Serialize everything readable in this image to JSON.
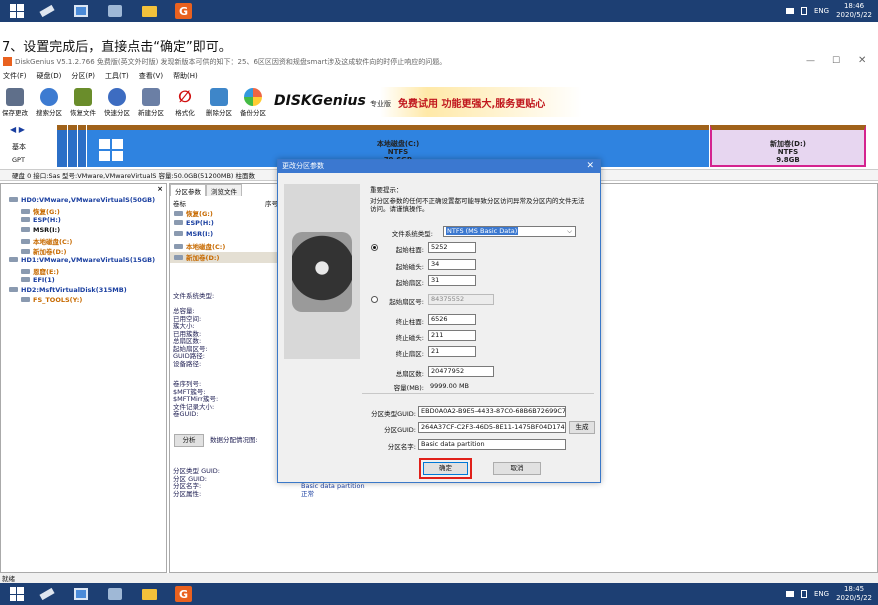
{
  "taskbar": {
    "lang": "ENG",
    "top_time": "18:46",
    "top_date": "2020/5/22",
    "bottom_time": "18:45",
    "bottom_date": "2020/5/22"
  },
  "caption": "7、设置完成后，直接点击“确定”即可。",
  "app": {
    "title": "DiskGenius V5.1.2.766 免费版(英文外时版)   发现新版本可供的知下：25、6区区因资和规盘smart涉及这成软件向的时停止响应的问题。",
    "menu": [
      "文件(F)",
      "硬盘(D)",
      "分区(P)",
      "工具(T)",
      "查看(V)",
      "帮助(H)"
    ],
    "toolbar": [
      "保存更改",
      "搜索分区",
      "恢复文件",
      "快速分区",
      "新建分区",
      "格式化",
      "删除分区",
      "备份分区"
    ],
    "banner_brand": "DISKGenius",
    "banner_tag": "专业版",
    "banner_text": "免费试用 功能更强大,服务更贴心"
  },
  "disk": {
    "basic": "基本",
    "gpt": "GPT",
    "main_name": "本地磁盘(C:)",
    "main_fs": "NTFS",
    "main_size": "79.6GB",
    "right_name": "新加卷(D:)",
    "right_fs": "NTFS",
    "right_size": "9.8GB",
    "info": "硬盘 0 接口:Sas  型号:VMware,VMwareVirtualS  容量:50.0GB(51200MB)  柱面数"
  },
  "tree": [
    {
      "text": "HD0:VMware,VMwareVirtualS(50GB)",
      "cls": "blue"
    },
    {
      "text": "恢复(G:)",
      "cls": "orange"
    },
    {
      "text": "ESP(H:)",
      "cls": "blue"
    },
    {
      "text": "MSR(I:)",
      "cls": ""
    },
    {
      "text": "本地磁盘(C:)",
      "cls": "orange"
    },
    {
      "text": "新加卷(D:)",
      "cls": "orange"
    },
    {
      "text": "HD1:VMware,VMwareVirtualS(15GB)",
      "cls": "blue"
    },
    {
      "text": "恩窟(E:)",
      "cls": "orange"
    },
    {
      "text": "EFI(1)",
      "cls": "blue"
    },
    {
      "text": "HD2:MsftVirtualDisk(315MB)",
      "cls": "blue"
    },
    {
      "text": "FS_TOOLS(Y:)",
      "cls": "orange"
    }
  ],
  "panel": {
    "tab1": "分区参数",
    "tab2": "浏览文件",
    "col_label": "卷标",
    "col_seq": "序号",
    "partitions": [
      "恢复(G:)",
      "ESP(H:)",
      "MSR(I:)",
      "本地磁盘(C:)",
      "新加卷(D:)"
    ],
    "fs_type_label": "文件系统类型:",
    "info_labels": [
      "总容量:",
      "已用空间:",
      "簇大小:",
      "已用簇数:",
      "总扇区数:",
      "起始扇区号:",
      "GUID路径:",
      "设备路径:"
    ],
    "info_labels2": [
      "卷序列号:",
      "$MFT簇号:",
      "$MFTMirr簇号:",
      "文件记录大小:",
      "卷GUID:"
    ],
    "analyze_button": "分析",
    "analyze_label": "数据分配情况图:",
    "bottom_labels": [
      "分区类型 GUID:",
      "分区 GUID:",
      "分区名字:",
      "分区属性:"
    ],
    "bottom_values": [
      "",
      "",
      "Basic data partition",
      "正常"
    ]
  },
  "dialog": {
    "title": "更改分区参数",
    "notice_title": "重要提示：",
    "notice_text": "对分区参数的任何不正确设置都可能导致分区访问异常及分区内的文件无法访问。请谨慎操作。",
    "fs_label": "文件系统类型:",
    "fs_value": "NTFS (MS Basic Data)",
    "start_cyl_label": "起始柱面:",
    "start_cyl": "5252",
    "start_head_label": "起始磁头:",
    "start_head": "34",
    "start_sector_label": "起始扇区:",
    "start_sector": "31",
    "lba_label": "起始扇区号:",
    "lba_value": "84375552",
    "end_cyl_label": "终止柱面:",
    "end_cyl": "6526",
    "end_head_label": "终止磁头:",
    "end_head": "211",
    "end_sector_label": "终止扇区:",
    "end_sector": "21",
    "total_label": "总扇区数:",
    "total_value": "20477952",
    "capacity_label": "容量(MB):",
    "capacity_value": "9999.00 MB",
    "type_guid_label": "分区类型GUID:",
    "type_guid": "EBD0A0A2-B9E5-4433-87C0-68B6B72699C7",
    "part_guid_label": "分区GUID:",
    "part_guid": "264A37CF-C2F3-46D5-8E11-1475BF04D174",
    "generate_button": "生成",
    "name_label": "分区名字:",
    "name_value": "Basic data partition",
    "ok_button": "确定",
    "cancel_button": "取消",
    "highlight_color": "#e0201a"
  },
  "status": "就绪"
}
